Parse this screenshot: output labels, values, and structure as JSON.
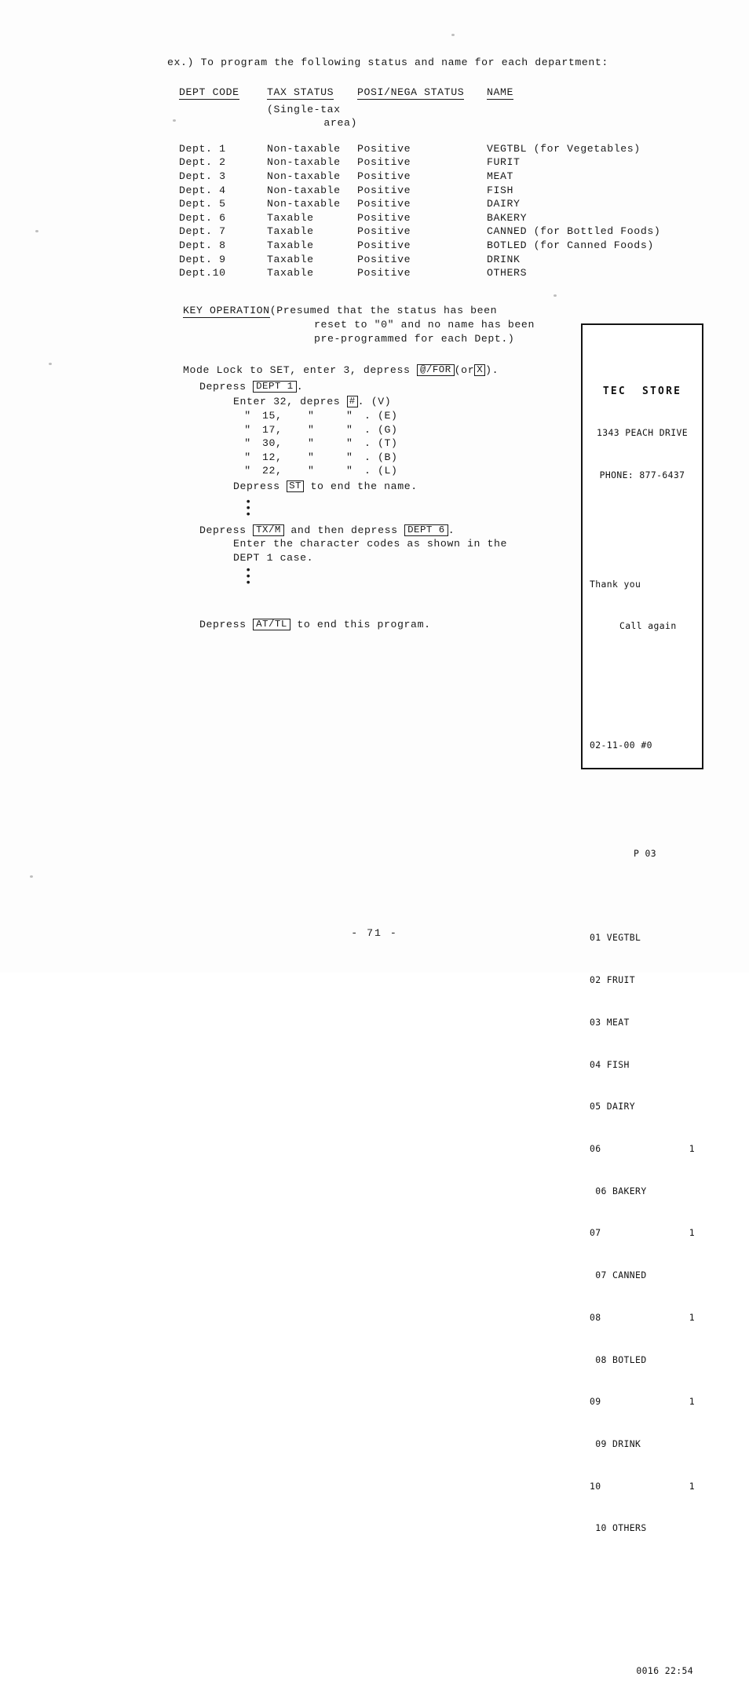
{
  "intro": {
    "text": "ex.) To program the following status and name for each department:"
  },
  "table": {
    "headers": {
      "dept_code": "DEPT CODE",
      "tax_status": "TAX STATUS",
      "posi_nega_status": "POSI/NEGA STATUS",
      "name": "NAME"
    },
    "subheader_line1": "(Single-tax",
    "subheader_line2": "area)",
    "rows": [
      {
        "code": "Dept. 1",
        "tax": "Non-taxable",
        "posi": "Positive",
        "name": "VEGTBL (for Vegetables)"
      },
      {
        "code": "Dept. 2",
        "tax": "Non-taxable",
        "posi": "Positive",
        "name": "FURIT"
      },
      {
        "code": "Dept. 3",
        "tax": "Non-taxable",
        "posi": "Positive",
        "name": "MEAT"
      },
      {
        "code": "Dept. 4",
        "tax": "Non-taxable",
        "posi": "Positive",
        "name": "FISH"
      },
      {
        "code": "Dept. 5",
        "tax": "Non-taxable",
        "posi": "Positive",
        "name": "DAIRY"
      },
      {
        "code": "Dept. 6",
        "tax": "Taxable",
        "posi": "Positive",
        "name": "BAKERY"
      },
      {
        "code": "Dept. 7",
        "tax": "Taxable",
        "posi": "Positive",
        "name": "CANNED (for Bottled Foods)"
      },
      {
        "code": "Dept. 8",
        "tax": "Taxable",
        "posi": "Positive",
        "name": "BOTLED (for Canned Foods)"
      },
      {
        "code": "Dept. 9",
        "tax": "Taxable",
        "posi": "Positive",
        "name": "DRINK"
      },
      {
        "code": "Dept.10",
        "tax": "Taxable",
        "posi": "Positive",
        "name": "OTHERS"
      }
    ]
  },
  "key_operation": {
    "title": "KEY OPERATION",
    "note_line1": "(Presumed that the status has been",
    "note_line2": "reset to \"0\" and no name has been",
    "note_line3": "pre-programmed for each Dept.)",
    "mode_line_pre": "Mode Lock to SET, enter 3, depress ",
    "key_at_for": "@/FOR",
    "mode_line_mid": "(or",
    "key_x": "X",
    "mode_line_end": ").",
    "depress_pre": "Depress ",
    "key_dept1": "DEPT 1",
    "depress_end": ".",
    "enter_first_pre": "Enter 32, depres ",
    "key_hash": "#",
    "enter_first_end": ". (V)",
    "char_rows": [
      {
        "ditto1": "\"",
        "code": "15,",
        "ditto2": "\"",
        "ditto3": "\"",
        "letter": ". (E)"
      },
      {
        "ditto1": "\"",
        "code": "17,",
        "ditto2": "\"",
        "ditto3": "\"",
        "letter": ". (G)"
      },
      {
        "ditto1": "\"",
        "code": "30,",
        "ditto2": "\"",
        "ditto3": "\"",
        "letter": ". (T)"
      },
      {
        "ditto1": "\"",
        "code": "12,",
        "ditto2": "\"",
        "ditto3": "\"",
        "letter": ". (B)"
      },
      {
        "ditto1": "\"",
        "code": "22,",
        "ditto2": "\"",
        "ditto3": "\"",
        "letter": ". (L)"
      }
    ],
    "end_name_pre": "Depress ",
    "key_st": "ST",
    "end_name_post": " to end the name.",
    "ellipsis": "•",
    "txm_pre": "Depress ",
    "key_txm": "TX/M",
    "txm_mid": " and then depress ",
    "key_dept6": "DEPT 6",
    "txm_end": ".",
    "char_codes_line1": "Enter the character codes as shown in the",
    "char_codes_line2": "DEPT 1 case.",
    "attl_pre": "Depress ",
    "key_attl": "AT/TL",
    "attl_post": " to end this program."
  },
  "receipt": {
    "store_name": "TEC  STORE",
    "address": "1343 PEACH DRIVE",
    "phone": "PHONE: 877-6437",
    "thank_you": "Thank you",
    "call_again": "Call again",
    "date_line": "02-11-00 #0",
    "program_code": "P 03",
    "items": [
      {
        "label": "01 VEGTBL",
        "qty": ""
      },
      {
        "label": "02 FRUIT",
        "qty": ""
      },
      {
        "label": "03 MEAT",
        "qty": ""
      },
      {
        "label": "04 FISH",
        "qty": ""
      },
      {
        "label": "05 DAIRY",
        "qty": ""
      },
      {
        "label": "06",
        "qty": "1"
      },
      {
        "label": " 06 BAKERY",
        "qty": ""
      },
      {
        "label": "07",
        "qty": "1"
      },
      {
        "label": " 07 CANNED",
        "qty": ""
      },
      {
        "label": "08",
        "qty": "1"
      },
      {
        "label": " 08 BOTLED",
        "qty": ""
      },
      {
        "label": "09",
        "qty": "1"
      },
      {
        "label": " 09 DRINK",
        "qty": ""
      },
      {
        "label": "10",
        "qty": "1"
      },
      {
        "label": " 10 OTHERS",
        "qty": ""
      }
    ],
    "footer": "0016 22:54"
  },
  "footer": {
    "page_number": "- 71 -"
  }
}
